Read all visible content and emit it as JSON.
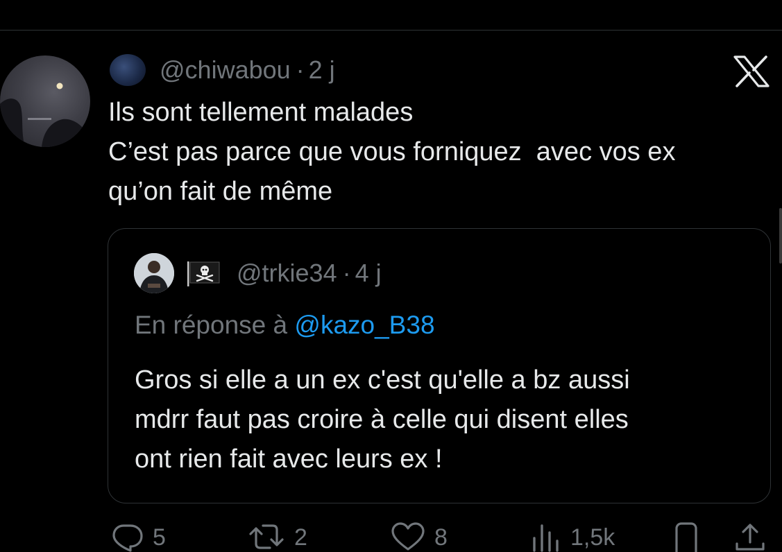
{
  "tweet": {
    "handle": "@chiwabou",
    "separator": "·",
    "time": "2 j",
    "lines": [
      "Ils sont tellement malades",
      "C’est pas parce que vous forniquez  avec vos ex",
      "qu’on fait de même"
    ]
  },
  "quoted_tweet": {
    "flag_icon": "pirate-flag-icon",
    "handle": "@trkie34",
    "separator": "·",
    "time": "4 j",
    "reply_prefix": "En réponse à",
    "reply_mention": "@kazo_B38",
    "lines": [
      "Gros si elle a un ex c'est qu'elle a bz aussi",
      "mdrr faut pas croire à celle qui disent elles",
      "ont rien fait avec leurs ex !"
    ]
  },
  "actions": {
    "replies": "5",
    "retweets": "2",
    "likes": "8",
    "views": "1,5k"
  },
  "colors": {
    "background": "#000000",
    "text": "#e7e9ea",
    "muted": "#71767b",
    "link": "#1d9bf0",
    "border": "#2f3336"
  }
}
